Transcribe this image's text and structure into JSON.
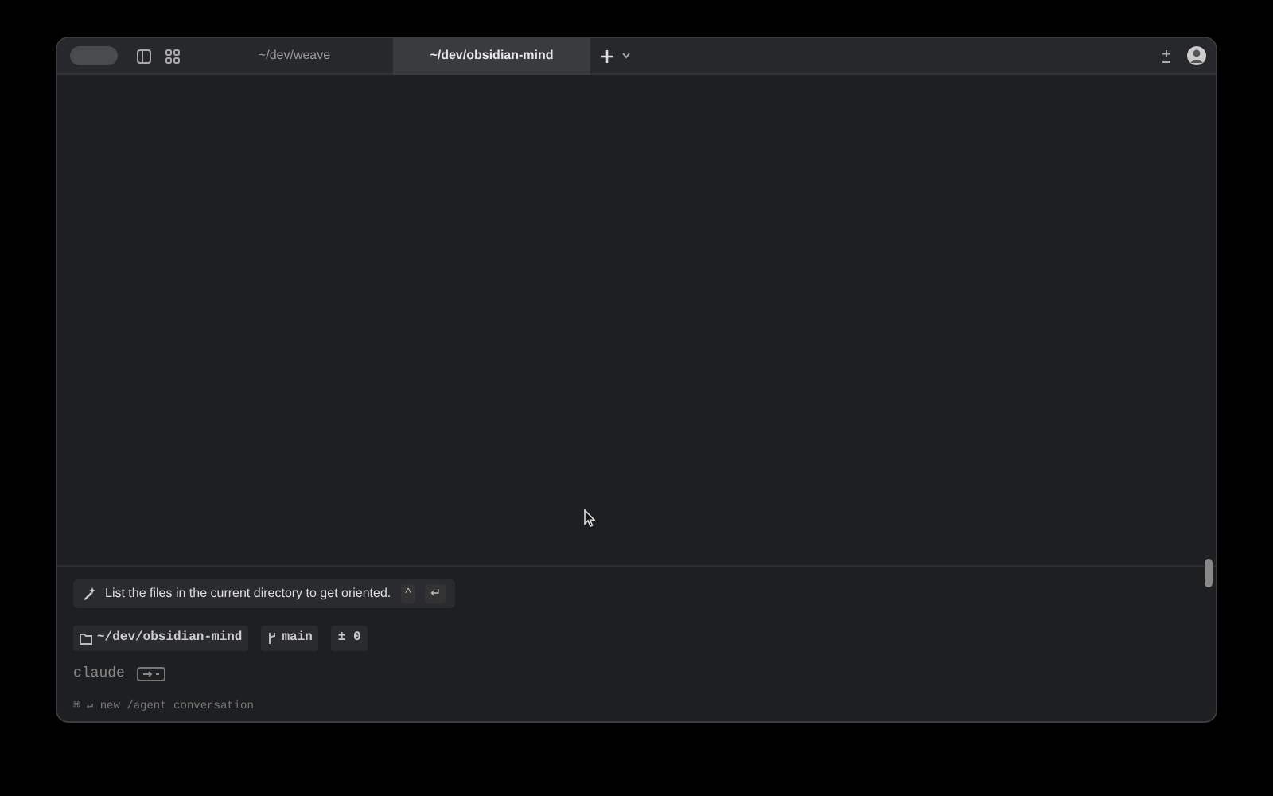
{
  "tabs": [
    {
      "label": "~/dev/weave",
      "selected": false
    },
    {
      "label": "~/dev/obsidian-mind",
      "selected": true
    }
  ],
  "suggestion": {
    "text": "List the files in the current directory to get oriented.",
    "keys": [
      "^",
      "↵"
    ]
  },
  "context_chips": [
    {
      "kind": "folder",
      "label": "~/dev/obsidian-mind"
    },
    {
      "kind": "branch",
      "label": "main"
    },
    {
      "kind": "diff",
      "label": "± 0"
    }
  ],
  "prompt": {
    "label": "claude"
  },
  "footer_hint": "⌘ ↵ new /agent conversation"
}
